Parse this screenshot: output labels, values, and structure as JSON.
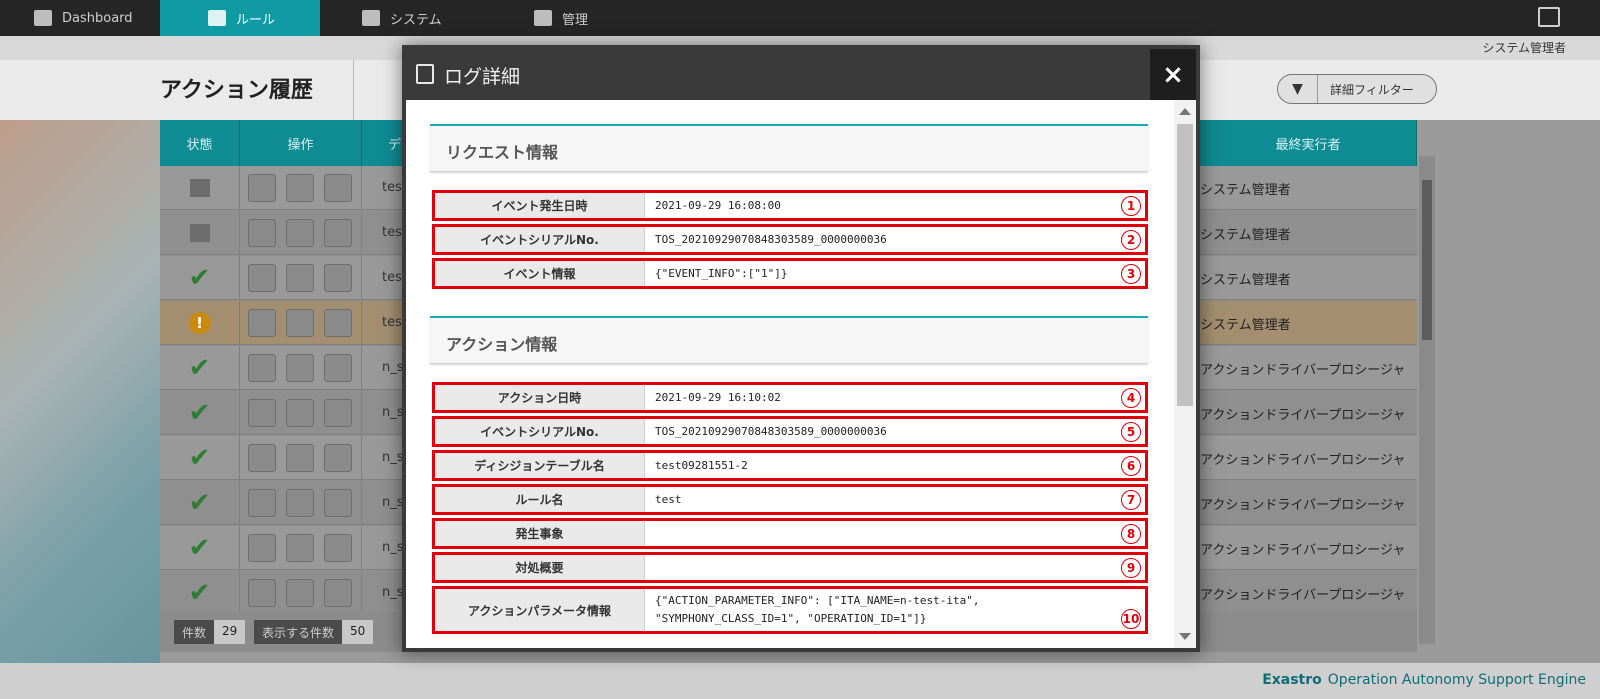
{
  "nav": {
    "items": [
      {
        "label": "Dashboard",
        "icon": "dashboard-icon"
      },
      {
        "label": "ルール",
        "icon": "scales-icon"
      },
      {
        "label": "システム",
        "icon": "gears-icon"
      },
      {
        "label": "管理",
        "icon": "admin-icon"
      }
    ]
  },
  "header": {
    "user": "システム管理者",
    "page_title": "アクション履歴",
    "filter_label": "詳細フィルター"
  },
  "table": {
    "columns": [
      "状態",
      "操作",
      "デ",
      "最終実行者"
    ],
    "rows": [
      {
        "status": "gray",
        "short": "tes",
        "exec": "システム管理者"
      },
      {
        "status": "gray",
        "short": "tes",
        "exec": "システム管理者"
      },
      {
        "status": "check",
        "short": "tes",
        "exec": "システム管理者"
      },
      {
        "status": "warn",
        "short": "tes",
        "exec": "システム管理者"
      },
      {
        "status": "check",
        "short": "n_s",
        "exec": "アクションドライバープロシージャ"
      },
      {
        "status": "check",
        "short": "n_s",
        "exec": "アクションドライバープロシージャ"
      },
      {
        "status": "check",
        "short": "n_s",
        "exec": "アクションドライバープロシージャ"
      },
      {
        "status": "check",
        "short": "n_s",
        "exec": "アクションドライバープロシージャ"
      },
      {
        "status": "check",
        "short": "n_s",
        "exec": "アクションドライバープロシージャ"
      },
      {
        "status": "check",
        "short": "n_s",
        "exec": "アクションドライバープロシージャ"
      }
    ],
    "count_label": "件数",
    "count_value": "29",
    "per_page_label": "表示する件数",
    "per_page_value": "50"
  },
  "footer": {
    "brand_bold": "Exastro",
    "brand_rest": "Operation Autonomy Support Engine"
  },
  "modal": {
    "title": "ログ詳細",
    "close": "×",
    "request_section": "リクエスト情報",
    "request_fields": [
      {
        "label": "イベント発生日時",
        "value": "2021-09-29 16:08:00",
        "num": "1"
      },
      {
        "label": "イベントシリアルNo.",
        "value": "TOS_20210929070848303589_0000000036",
        "num": "2"
      },
      {
        "label": "イベント情報",
        "value": "{\"EVENT_INFO\":[\"1\"]}",
        "num": "3"
      }
    ],
    "action_section": "アクション情報",
    "action_fields": [
      {
        "label": "アクション日時",
        "value": "2021-09-29 16:10:02",
        "num": "4"
      },
      {
        "label": "イベントシリアルNo.",
        "value": "TOS_20210929070848303589_0000000036",
        "num": "5"
      },
      {
        "label": "ディシジョンテーブル名",
        "value": "test09281551-2",
        "num": "6"
      },
      {
        "label": "ルール名",
        "value": "test",
        "num": "7"
      },
      {
        "label": "発生事象",
        "value": "",
        "num": "8"
      },
      {
        "label": "対処概要",
        "value": "",
        "num": "9"
      },
      {
        "label": "アクションパラメータ情報",
        "value": "{\"ACTION_PARAMETER_INFO\": [\"ITA_NAME=n-test-ita\", \"SYMPHONY_CLASS_ID=1\", \"OPERATION_ID=1\"]}",
        "num": "10"
      }
    ]
  }
}
